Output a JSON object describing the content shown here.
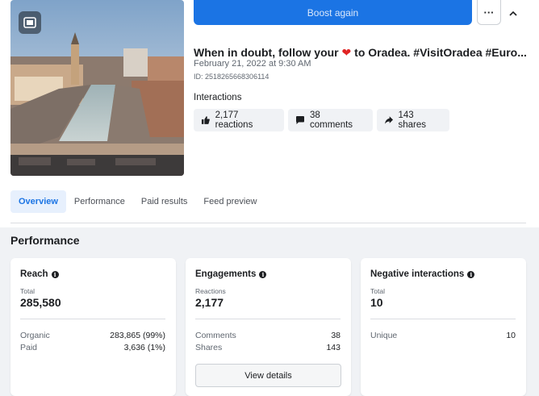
{
  "actions": {
    "boost_label": "Boost again",
    "more_label": "···"
  },
  "post": {
    "title_before": "When in doubt, follow your",
    "heart": "❤",
    "title_after": "to Oradea. #VisitOradea #Euro...",
    "date": "February 21, 2022 at 9:30 AM",
    "id": "ID: 2518265668306114"
  },
  "interactions": {
    "label": "Interactions",
    "reactions": "2,177 reactions",
    "comments": "38 comments",
    "shares": "143 shares"
  },
  "tabs": [
    {
      "label": "Overview",
      "active": true
    },
    {
      "label": "Performance",
      "active": false
    },
    {
      "label": "Paid results",
      "active": false
    },
    {
      "label": "Feed preview",
      "active": false
    }
  ],
  "performance": {
    "title": "Performance",
    "reach": {
      "title": "Reach",
      "sub_label": "Total",
      "total": "285,580",
      "rows": [
        {
          "label": "Organic",
          "value": "283,865 (99%)"
        },
        {
          "label": "Paid",
          "value": "3,636 (1%)"
        }
      ]
    },
    "engagements": {
      "title": "Engagements",
      "sub_label": "Reactions",
      "total": "2,177",
      "rows": [
        {
          "label": "Comments",
          "value": "38"
        },
        {
          "label": "Shares",
          "value": "143"
        }
      ],
      "button": "View details"
    },
    "negative": {
      "title": "Negative interactions",
      "sub_label": "Total",
      "total": "10",
      "rows": [
        {
          "label": "Unique",
          "value": "10"
        }
      ]
    }
  },
  "colors": {
    "accent": "#1b74e4",
    "heart": "#e02424",
    "background": "#f0f2f5"
  }
}
